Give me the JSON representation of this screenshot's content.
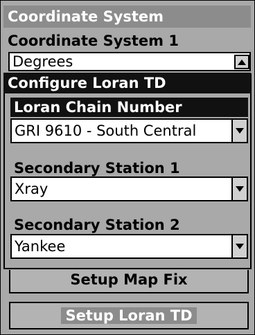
{
  "screen_title": "Coordinate System",
  "coordinate_system": {
    "label": "Coordinate System 1",
    "value": "Degrees"
  },
  "dialog": {
    "title": "Configure Loran TD",
    "chain": {
      "label": "Loran Chain Number",
      "value": "GRI 9610 - South Central"
    },
    "secondary1": {
      "label": "Secondary Station 1",
      "value": "Xray"
    },
    "secondary2": {
      "label": "Secondary Station 2",
      "value": "Yankee"
    }
  },
  "buttons": {
    "setup_map_fix": "Setup Map Fix",
    "setup_loran_td": "Setup Loran TD"
  },
  "icons": {
    "scroll_up": "triangle-up-icon",
    "dropdown": "triangle-down-icon"
  }
}
